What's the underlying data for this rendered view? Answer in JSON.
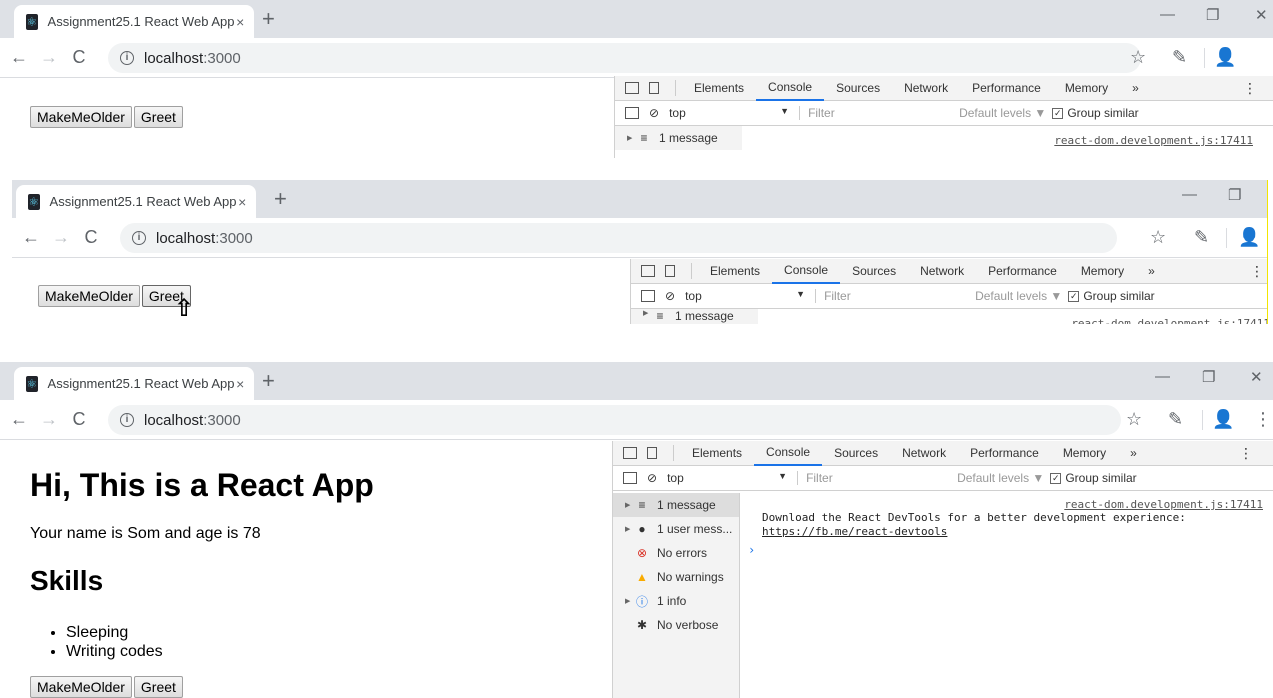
{
  "browser": {
    "tab_title": "Assignment25.1 React Web App",
    "tab_close": "×",
    "new_tab": "+",
    "url_host": "localhost",
    "url_port": ":3000",
    "back": "←",
    "forward": "→",
    "reload": "C",
    "star": "☆",
    "eyedropper": "✎",
    "profile": "👤",
    "menu": "⋮",
    "minimize": "—",
    "restore": "❐",
    "close": "✕"
  },
  "page": {
    "make_older_label": "MakeMeOlder",
    "greet_label": "Greet",
    "heading": "Hi, This is a React App",
    "name_age_text": "Your name is Som and age is 78",
    "skills_heading": "Skills",
    "skills": [
      "Sleeping",
      "Writing codes"
    ]
  },
  "devtools": {
    "tabs": [
      "Elements",
      "Console",
      "Sources",
      "Network",
      "Performance",
      "Memory"
    ],
    "more_tabs": "»",
    "active_tab": "Console",
    "context": "top",
    "context_arrow": "▼",
    "filter_placeholder": "Filter",
    "default_levels": "Default levels ▼",
    "group_similar": "Group similar",
    "source_link": "react-dom.development.js:17411",
    "sidebar": [
      {
        "label": "1 message",
        "icon": "list-icon"
      },
      {
        "label": "1 user mess...",
        "icon": "user-icon"
      },
      {
        "label": "No errors",
        "icon": "error-icon"
      },
      {
        "label": "No warnings",
        "icon": "warning-icon"
      },
      {
        "label": "1 info",
        "icon": "info-icon"
      },
      {
        "label": "No verbose",
        "icon": "bug-icon"
      }
    ],
    "log_text": "Download the React DevTools for a better development experience: ",
    "log_link": "https://fb.me/react-devtools",
    "prompt": "›"
  },
  "colors": {
    "accent": "#1a73e8",
    "tabstrip": "#dee1e6",
    "error": "#d93025",
    "warning": "#f9ab00",
    "info": "#1a73e8"
  }
}
